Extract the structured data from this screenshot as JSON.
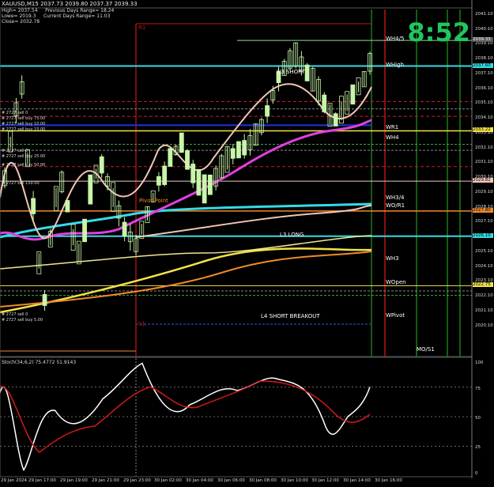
{
  "symbol_title": "XAUUSD,M15",
  "ohlc_text": "2037.73 2039.80 2037.37 2039.33",
  "info_lines": [
    "High= 2037.54     Previous Days Range= 18.24",
    "Lowe= 2019.3     Current Days Range= 11.03",
    "Close= 2032.78"
  ],
  "timer": "8:52",
  "colors": {
    "background": "#000000",
    "candle": "#c8f5a8",
    "pink_ma": "#e040e0",
    "light_ma": "#f2c6b8",
    "yellow_ma": "#f2e24a",
    "orange_ma": "#f08a2c",
    "cyan_line": "#35dbe6",
    "blue_line": "#1f33d8",
    "stoch_main": "#ffffff",
    "stoch_signal": "#d0181e",
    "green_vline": "#1f9a1f",
    "red_vline": "#c41414"
  },
  "price_axis": {
    "ticks": [
      "2041.10",
      "2040.10",
      "2039.10",
      "2038.10",
      "2037.10",
      "2036.10",
      "2035.10",
      "2034.10",
      "2033.10",
      "2032.10",
      "2031.10",
      "2030.10",
      "2029.10",
      "2028.10",
      "2027.10",
      "2026.10",
      "2025.10",
      "2024.10",
      "2023.10",
      "2022.10",
      "2021.10",
      "2020.10"
    ],
    "badges": [
      {
        "text": "2039.33",
        "bg": "#5a5a5a",
        "fg": "#ffffff",
        "price": 2039.33
      },
      {
        "text": "2037.60",
        "bg": "#35dbe6",
        "fg": "#000000",
        "price": 2037.6
      },
      {
        "text": "2033.22",
        "bg": "#f2e24a",
        "fg": "#000000",
        "price": 2033.22
      },
      {
        "text": "2029.82",
        "bg": "#f2c6b8",
        "fg": "#000000",
        "price": 2029.82
      },
      {
        "text": "2027.80",
        "bg": "#f08a2c",
        "fg": "#000000",
        "price": 2027.8
      },
      {
        "text": "2026.10",
        "bg": "#35dbe6",
        "fg": "#000000",
        "price": 2026.1
      },
      {
        "text": "2022.75",
        "bg": "#f2e24a",
        "fg": "#000000",
        "price": 2022.75
      }
    ]
  },
  "time_axis": [
    "29 Jan 2024",
    "29 Jan 17:00",
    "29 Jan 19:00",
    "29 Jan 21:00",
    "29 Jan 23:00",
    "30 Jan 02:00",
    "30 Jan 04:00",
    "30 Jan 06:00",
    "30 Jan 08:00",
    "30 Jan 10:00",
    "30 Jan 12:00",
    "30 Jan 14:00",
    "30 Jan 16:00"
  ],
  "levels": [
    {
      "name": "R1",
      "label": "R1",
      "color": "#c41414"
    },
    {
      "name": "WH4/5",
      "label": "WH4/5",
      "color": "#ffffff"
    },
    {
      "name": "WHigh",
      "label": "WHigh",
      "color": "#ffffff"
    },
    {
      "name": "H3 SHORT",
      "label": "H3 SHORT",
      "color": "#ffffff"
    },
    {
      "name": "WR1",
      "label": "WR1",
      "color": "#ffffff"
    },
    {
      "name": "WH4",
      "label": "WH4",
      "color": "#ffffff"
    },
    {
      "name": "Pivot Point",
      "label": "Pivot Point",
      "color": "#f08a2c"
    },
    {
      "name": "WH3/4",
      "label": "WH3/4",
      "color": "#ffffff"
    },
    {
      "name": "WO/R1",
      "label": "WO/R1",
      "color": "#ffffff"
    },
    {
      "name": "L3 LONG",
      "label": "L3 LONG",
      "color": "#ffffff"
    },
    {
      "name": "WH3",
      "label": "WH3",
      "color": "#ffffff"
    },
    {
      "name": "WOpen",
      "label": "WOpen",
      "color": "#ffffff"
    },
    {
      "name": "L4 SHORT BREAKOUT",
      "label": "L4 SHORT BREAKOUT",
      "color": "#ffffff"
    },
    {
      "name": "WPivot",
      "label": "WPivot",
      "color": "#ffffff"
    },
    {
      "name": "S1",
      "label": "S1",
      "color": "#c41414"
    },
    {
      "name": "MO/S1",
      "label": "MO/S1",
      "color": "#ffffff"
    }
  ],
  "order_labels": [
    "# 2727 sell 0",
    "# 2727 sell buy 75.00",
    "# 2727 sell buy 10.00",
    "# 2727 sell buy 15.00",
    "# 2727 sell 0",
    "# 2727 sell buy 25.00",
    "# 2727 sell buy 50.00",
    "# 2727 sell 150.00",
    "# 2727 sell 0",
    "# 2727 sell buy 5.00"
  ],
  "stoch": {
    "label": "Stoch(34,6,2) 75.4772 51.9143",
    "ticks": [
      "100",
      "75",
      "50",
      "25",
      "0"
    ]
  }
}
